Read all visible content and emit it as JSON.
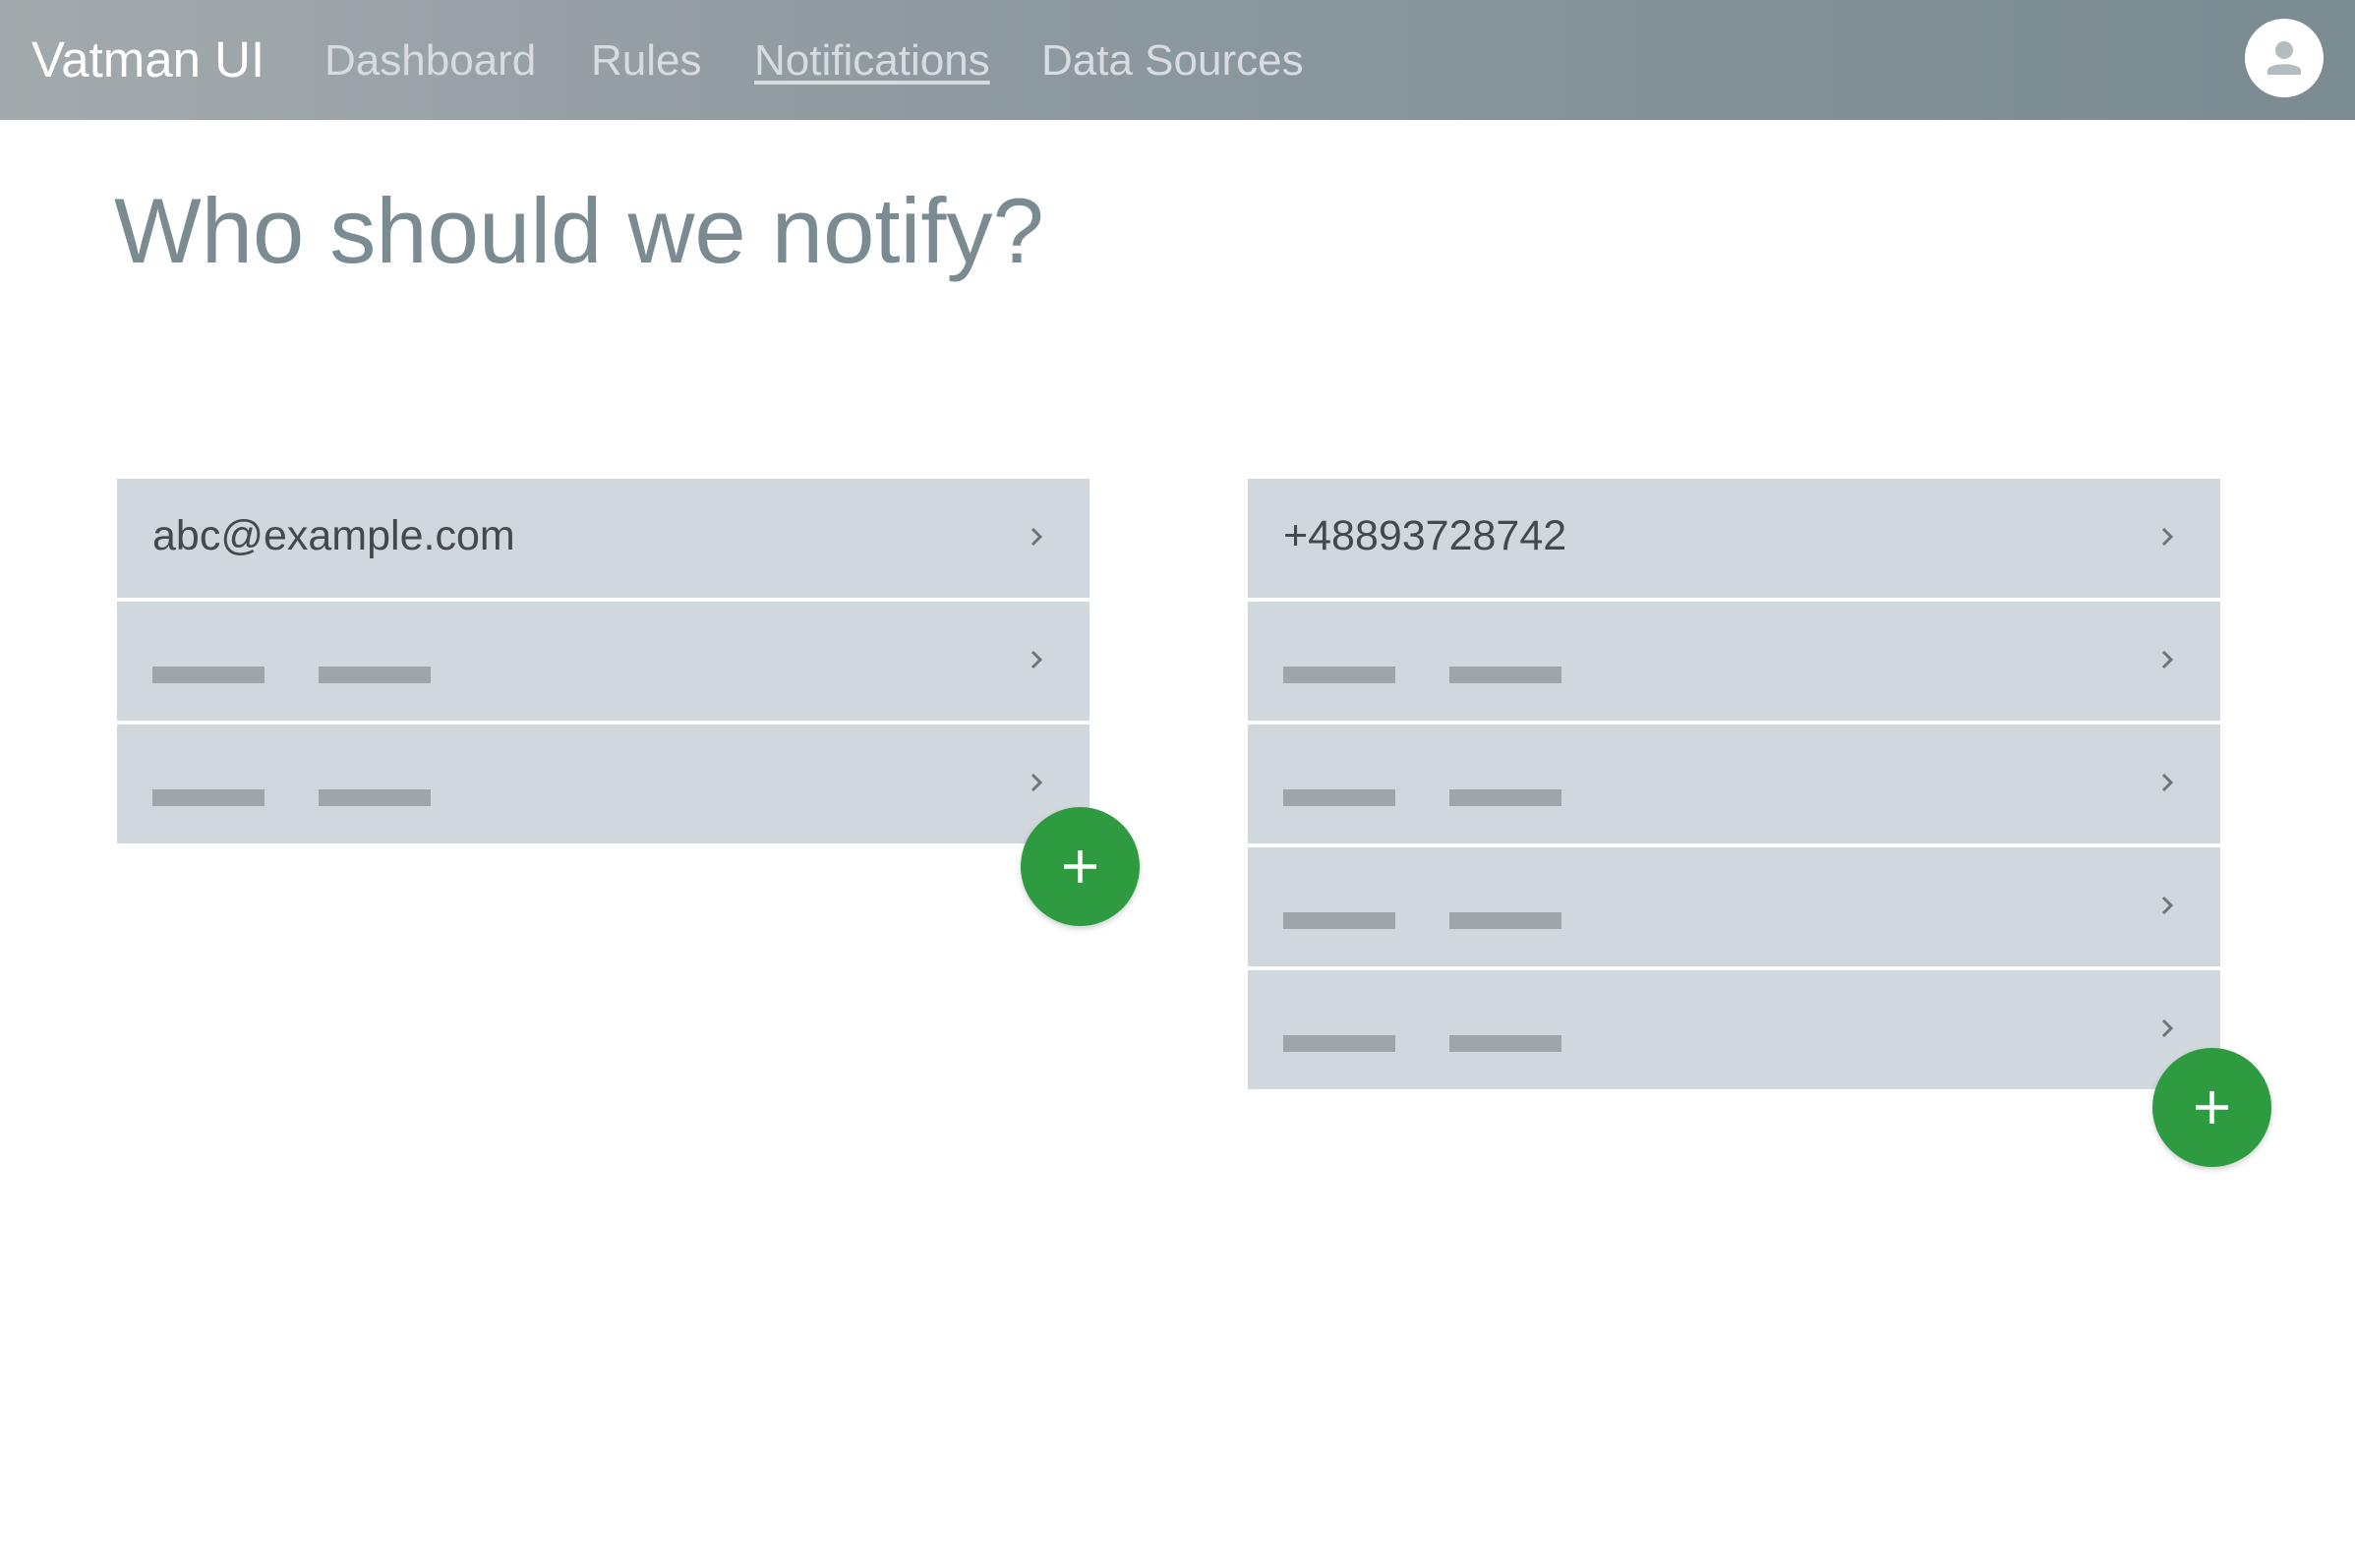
{
  "header": {
    "brand": "Vatman UI",
    "nav": [
      {
        "label": "Dashboard",
        "active": false
      },
      {
        "label": "Rules",
        "active": false
      },
      {
        "label": "Notifications",
        "active": true
      },
      {
        "label": "Data Sources",
        "active": false
      }
    ],
    "avatar_icon": "user-avatar-icon"
  },
  "main": {
    "title": "Who should we notify?",
    "email_list": {
      "items": [
        {
          "label": "abc@example.com",
          "placeholder": false
        },
        {
          "label": "",
          "placeholder": true
        },
        {
          "label": "",
          "placeholder": true
        }
      ],
      "add_icon": "plus-icon"
    },
    "phone_list": {
      "items": [
        {
          "label": "+48893728742",
          "placeholder": false
        },
        {
          "label": "",
          "placeholder": true
        },
        {
          "label": "",
          "placeholder": true
        },
        {
          "label": "",
          "placeholder": true
        },
        {
          "label": "",
          "placeholder": true
        }
      ],
      "add_icon": "plus-icon"
    }
  },
  "colors": {
    "header_gradient_start": "#a3aaad",
    "header_gradient_end": "#7a8b92",
    "title": "#7a8b92",
    "row_background": "#d1d8dd",
    "placeholder": "#9ea6a9",
    "fab": "#2e9b41"
  }
}
